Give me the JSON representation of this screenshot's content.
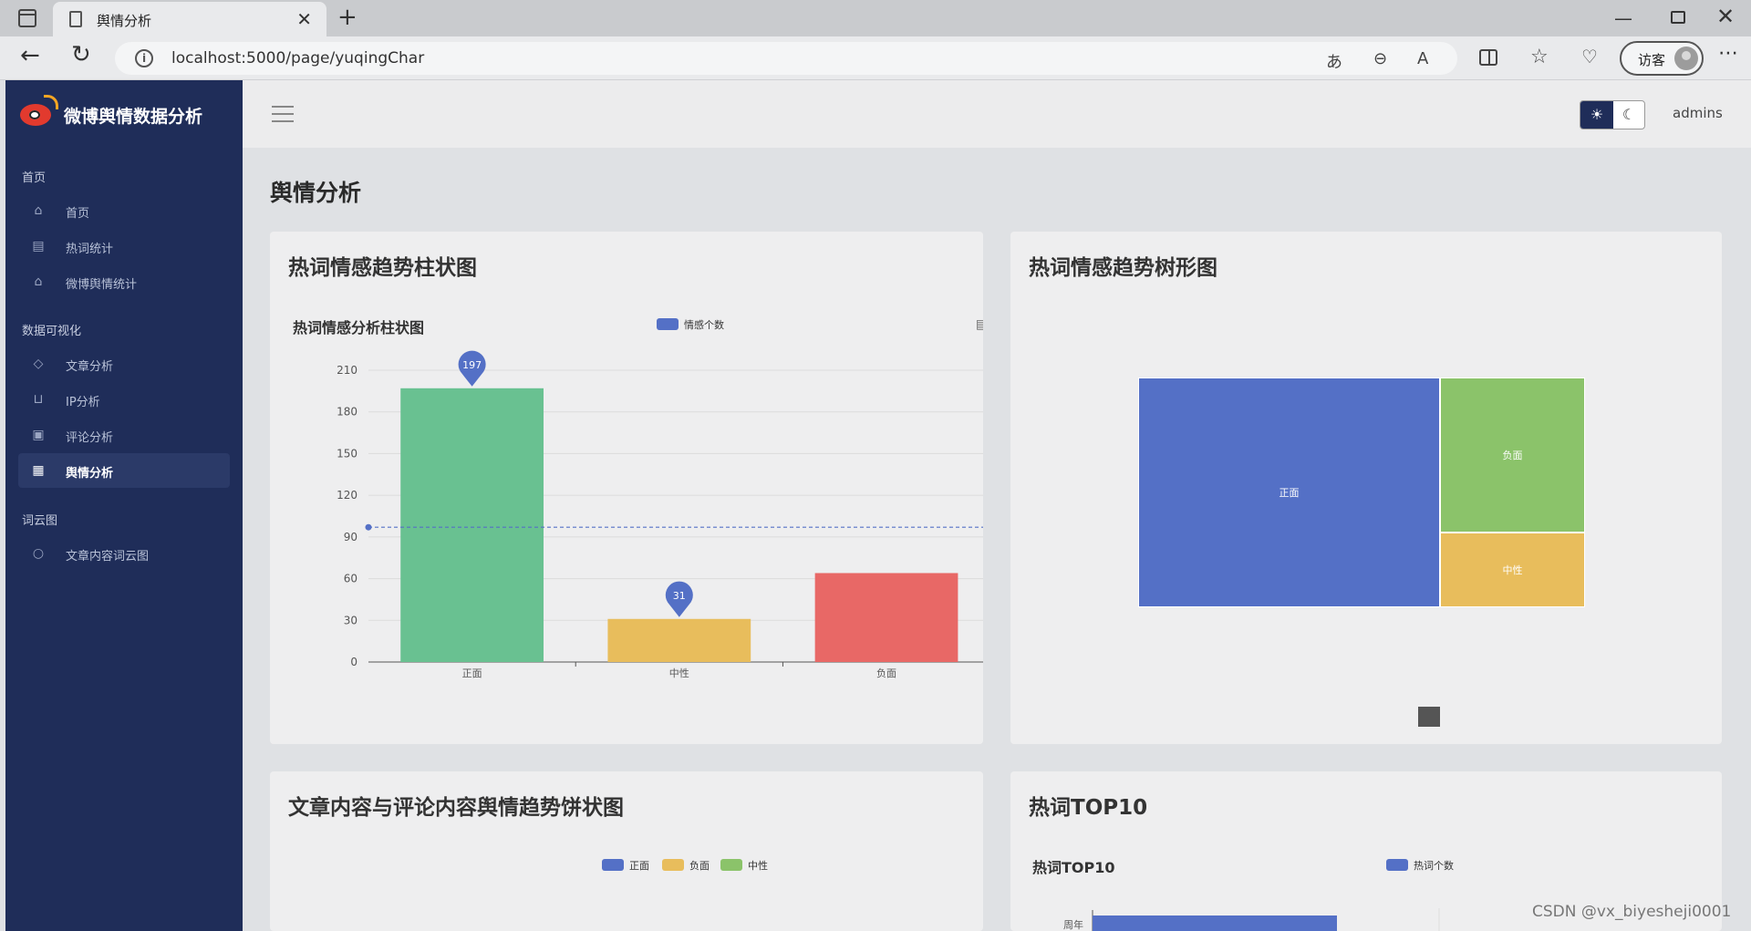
{
  "browser": {
    "tab_title": "舆情分析",
    "url": "localhost:5000/page/yuqingChar",
    "profile_label": "访客"
  },
  "sidebar": {
    "brand": "微博舆情数据分析",
    "sections": [
      {
        "title": "首页",
        "items": [
          {
            "label": "首页",
            "icon": "home-icon"
          },
          {
            "label": "热词统计",
            "icon": "table-icon"
          },
          {
            "label": "微博舆情统计",
            "icon": "bank-icon"
          }
        ]
      },
      {
        "title": "数据可视化",
        "items": [
          {
            "label": "文章分析",
            "icon": "tag-icon"
          },
          {
            "label": "IP分析",
            "icon": "cart-icon"
          },
          {
            "label": "评论分析",
            "icon": "chart-box-icon"
          },
          {
            "label": "舆情分析",
            "icon": "clipboard-icon",
            "active": true
          }
        ]
      },
      {
        "title": "词云图",
        "items": [
          {
            "label": "文章内容词云图",
            "icon": "message-icon"
          }
        ]
      }
    ]
  },
  "header": {
    "username": "admins"
  },
  "main": {
    "page_title": "舆情分析",
    "cards": {
      "bar": {
        "title": "热词情感趋势柱状图",
        "chart_title": "热词情感分析柱状图"
      },
      "treemap": {
        "title": "热词情感趋势树形图"
      },
      "pie": {
        "title": "文章内容与评论内容舆情趋势饼状图"
      },
      "top10": {
        "title": "热词TOP10",
        "chart_title": "热词TOP10"
      }
    }
  },
  "colors": {
    "positive": "#5470c6",
    "green": "#69c191",
    "yellow": "#e8bd5c",
    "red": "#e86866",
    "treemap_green": "#8bc36a"
  },
  "chart_data": [
    {
      "type": "bar",
      "title": "热词情感分析柱状图",
      "legend": [
        "情感个数"
      ],
      "categories": [
        "正面",
        "中性",
        "负面"
      ],
      "series": [
        {
          "name": "情感个数",
          "values": [
            197,
            31,
            64
          ]
        }
      ],
      "bar_colors": [
        "#69c191",
        "#e8bd5c",
        "#e86866"
      ],
      "ylim": [
        0,
        210
      ],
      "yticks": [
        0,
        30,
        60,
        90,
        120,
        150,
        180,
        210
      ],
      "mark_points": [
        {
          "category": "正面",
          "label": "197"
        },
        {
          "category": "中性",
          "label": "31"
        }
      ],
      "mark_line_value": 97,
      "grid": true,
      "legend_position": "top-center"
    },
    {
      "type": "treemap",
      "nodes": [
        {
          "name": "正面",
          "value": 197,
          "color": "#5470c6"
        },
        {
          "name": "负面",
          "value": 64,
          "color": "#8bc36a"
        },
        {
          "name": "中性",
          "value": 31,
          "color": "#e8bd5c"
        }
      ]
    },
    {
      "type": "pie",
      "legend": [
        "正面",
        "负面",
        "中性"
      ],
      "legend_colors": [
        "#5470c6",
        "#e8bd5c",
        "#8bc36a"
      ]
    },
    {
      "type": "bar",
      "title": "热词TOP10",
      "legend": [
        "热词个数"
      ],
      "categories": [
        "周年"
      ]
    }
  ],
  "watermark": "CSDN @vx_biyesheji0001"
}
